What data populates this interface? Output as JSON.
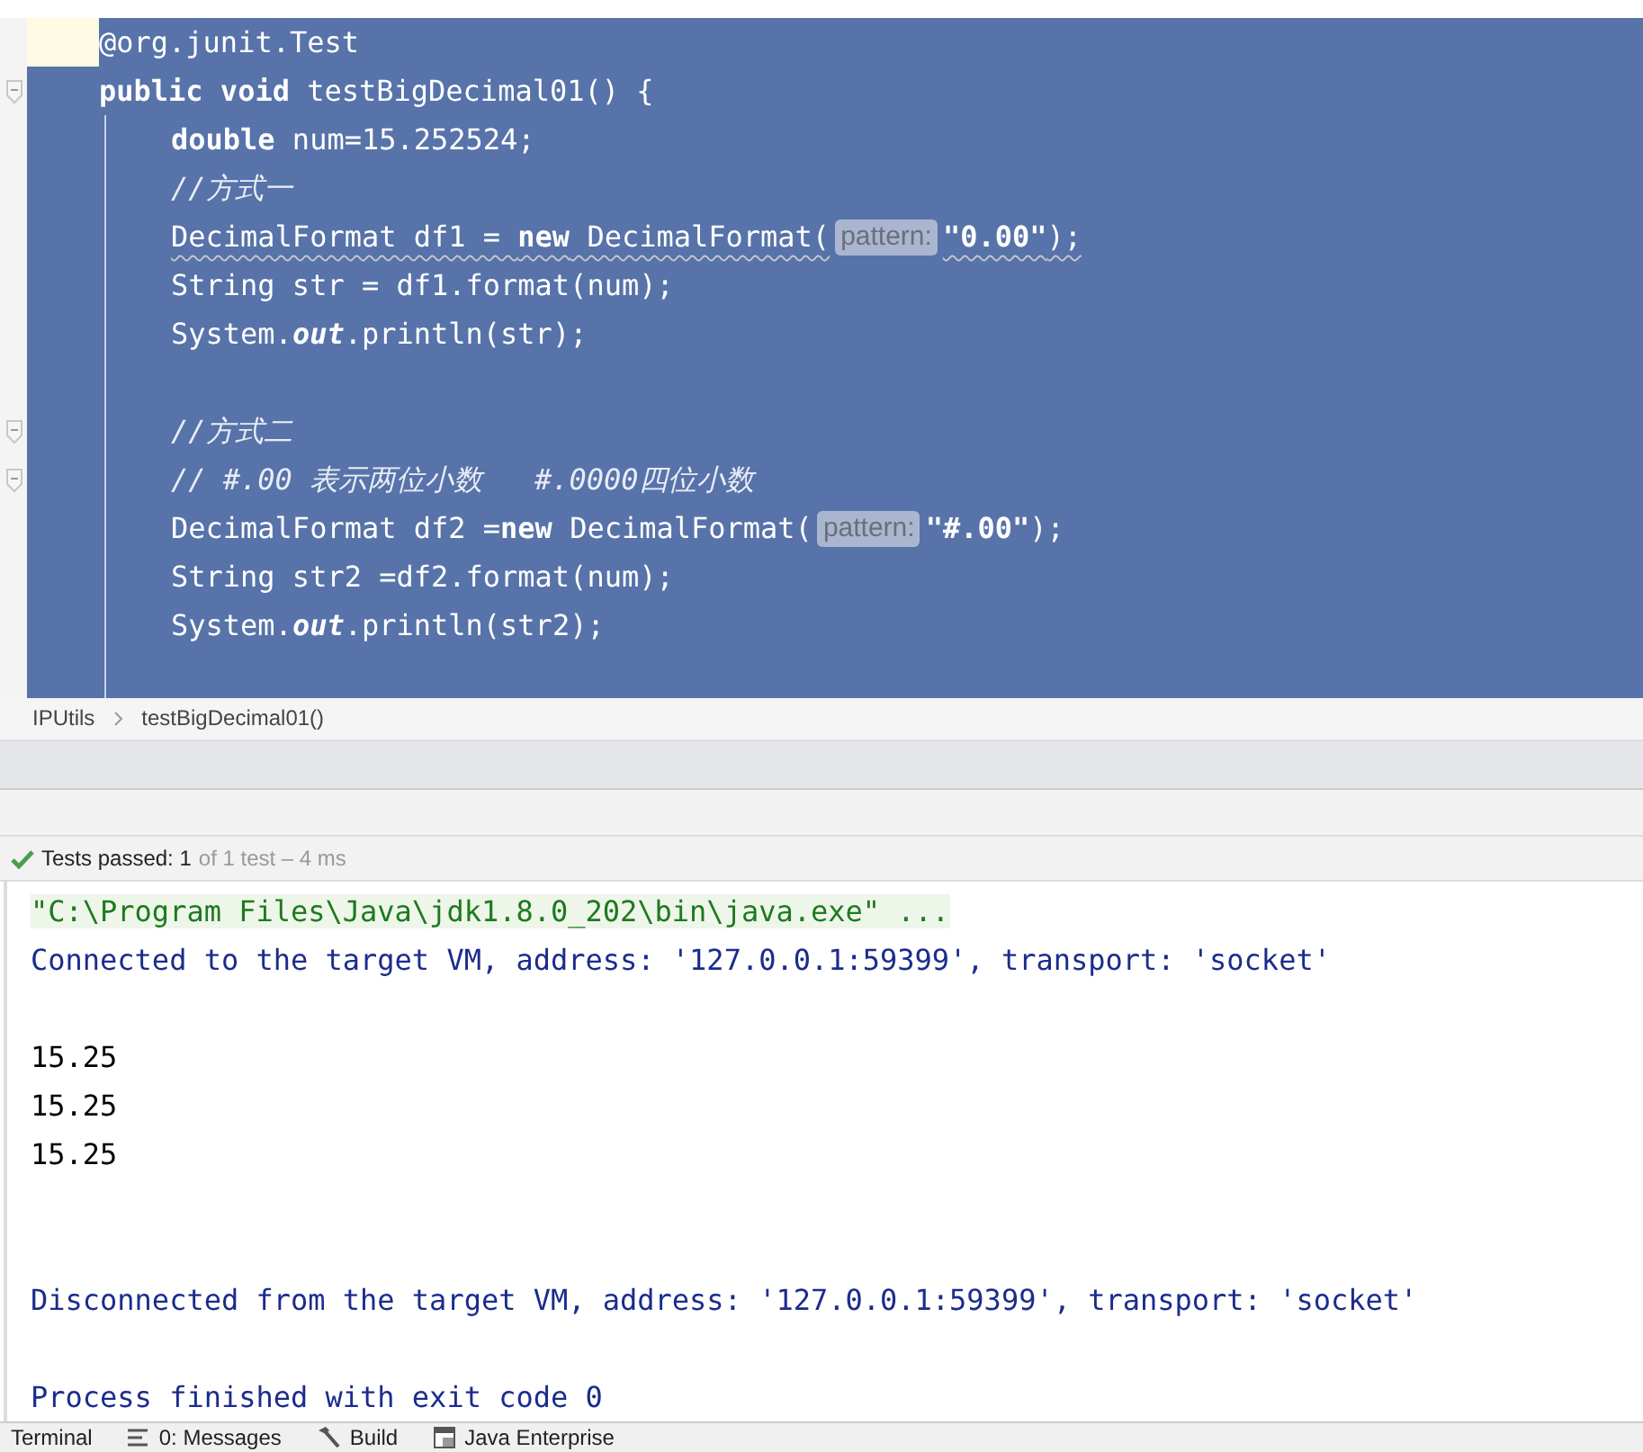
{
  "editor": {
    "lines": [
      {
        "kind": "code",
        "text": "@org.junit.Test",
        "current": true
      },
      {
        "kind": "code",
        "text": "**public void** testBigDecimal01() {",
        "fold": true,
        "children": [
          {
            "kind": "code",
            "text": "**double** num=15.252524;"
          },
          {
            "kind": "comment",
            "text": "//方式一"
          },
          {
            "kind": "code",
            "text": "DecimalFormat df1 = **new** DecimalFormat(",
            "hint": "pattern:",
            "after": "**\"0.00\"**);",
            "warning": true
          },
          {
            "kind": "code",
            "text": "String str = df1.format(num);"
          },
          {
            "kind": "code",
            "text": "System.*out*.println(str);"
          },
          {
            "kind": "blank"
          },
          {
            "kind": "comment",
            "text": "//方式二",
            "fold": true
          },
          {
            "kind": "comment",
            "text": "// #.00 表示两位小数   #.0000四位小数",
            "fold": true
          },
          {
            "kind": "code",
            "text": "DecimalFormat df2 =**new** DecimalFormat(",
            "hint": "pattern:",
            "after": "**\"#.00\"**);"
          },
          {
            "kind": "code",
            "text": "String str2 =df2.format(num);"
          },
          {
            "kind": "code",
            "text": "System.*out*.println(str2);"
          },
          {
            "kind": "blank"
          }
        ]
      }
    ]
  },
  "breadcrumb": [
    "IPUtils",
    "testBigDecimal01()"
  ],
  "test_status": {
    "label": "Tests passed: 1",
    "detail": "of 1 test – 4 ms"
  },
  "console": [
    {
      "kind": "command",
      "text": "\"C:\\Program Files\\Java\\jdk1.8.0_202\\bin\\java.exe\" ..."
    },
    {
      "kind": "system",
      "text": "Connected to the target VM, address: '127.0.0.1:59399', transport: 'socket'"
    },
    {
      "kind": "blank"
    },
    {
      "kind": "output",
      "text": "15.25"
    },
    {
      "kind": "output",
      "text": "15.25"
    },
    {
      "kind": "output",
      "text": "15.25"
    },
    {
      "kind": "blank"
    },
    {
      "kind": "blank"
    },
    {
      "kind": "system",
      "text": "Disconnected from the target VM, address: '127.0.0.1:59399', transport: 'socket'"
    },
    {
      "kind": "blank"
    },
    {
      "kind": "system",
      "text": "Process finished with exit code 0"
    }
  ],
  "tool_tabs": [
    {
      "label": "Terminal"
    },
    {
      "label": "0: Messages"
    },
    {
      "label": "Build"
    },
    {
      "label": "Java Enterprise"
    }
  ]
}
